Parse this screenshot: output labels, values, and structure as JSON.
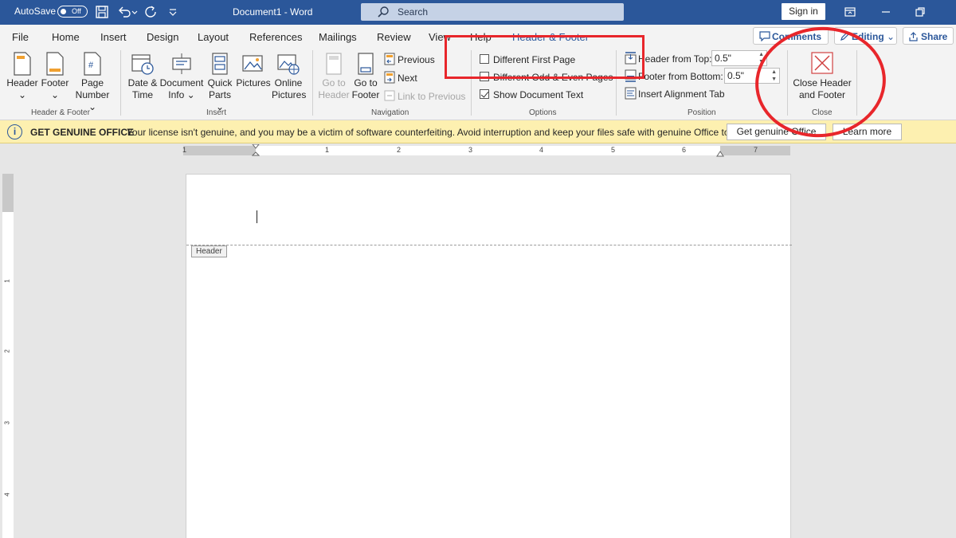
{
  "titlebar": {
    "autosave_label": "AutoSave",
    "autosave_state": "Off",
    "document_title": "Document1  -  Word",
    "search_placeholder": "Search",
    "sign_in": "Sign in"
  },
  "tabs": [
    {
      "label": "File"
    },
    {
      "label": "Home"
    },
    {
      "label": "Insert"
    },
    {
      "label": "Design"
    },
    {
      "label": "Layout"
    },
    {
      "label": "References"
    },
    {
      "label": "Mailings"
    },
    {
      "label": "Review"
    },
    {
      "label": "View"
    },
    {
      "label": "Help"
    },
    {
      "label": "Header & Footer"
    }
  ],
  "tab_actions": {
    "comments": "Comments",
    "editing": "Editing",
    "share": "Share"
  },
  "ribbon": {
    "header_footer": {
      "header_l1": "Header",
      "header_l2": "⌄",
      "footer_l1": "Footer",
      "footer_l2": "⌄",
      "pagenum_l1": "Page",
      "pagenum_l2": "Number ⌄",
      "group": "Header & Footer"
    },
    "insert": {
      "datetime_l1": "Date &",
      "datetime_l2": "Time",
      "docinfo_l1": "Document",
      "docinfo_l2": "Info ⌄",
      "quickparts_l1": "Quick",
      "quickparts_l2": "Parts ⌄",
      "pictures": "Pictures",
      "online_l1": "Online",
      "online_l2": "Pictures",
      "group": "Insert"
    },
    "navigation": {
      "goto_header_l1": "Go to",
      "goto_header_l2": "Header",
      "goto_footer_l1": "Go to",
      "goto_footer_l2": "Footer",
      "previous": "Previous",
      "next": "Next",
      "link_previous": "Link to Previous",
      "group": "Navigation"
    },
    "options": {
      "different_first": "Different First Page",
      "different_odd_even": "Different Odd & Even Pages",
      "show_doc_text": "Show Document Text",
      "group": "Options"
    },
    "position": {
      "header_top_label": "Header from Top:",
      "header_top_value": "0.5\"",
      "footer_bottom_label": "Footer from Bottom:",
      "footer_bottom_value": "0.5\"",
      "alignment_tab": "Insert Alignment Tab",
      "group": "Position"
    },
    "close": {
      "close_l1": "Close Header",
      "close_l2": "and Footer",
      "group": "Close"
    }
  },
  "infobar": {
    "title": "GET GENUINE OFFICE",
    "message": "Your license isn't genuine, and you may be a victim of software counterfeiting. Avoid interruption and keep your files safe with genuine Office today.",
    "get_genuine": "Get genuine Office",
    "learn_more": "Learn more"
  },
  "ruler": {
    "h_numbers": [
      "1",
      "1",
      "2",
      "3",
      "4",
      "5",
      "6",
      "7"
    ],
    "v_numbers": [
      "1",
      "2",
      "3",
      "4"
    ]
  },
  "document": {
    "header_tag": "Header"
  },
  "colors": {
    "word_blue": "#2b579a",
    "annotation_red": "#e8262b",
    "infobar_yellow": "#fdf0b0"
  }
}
